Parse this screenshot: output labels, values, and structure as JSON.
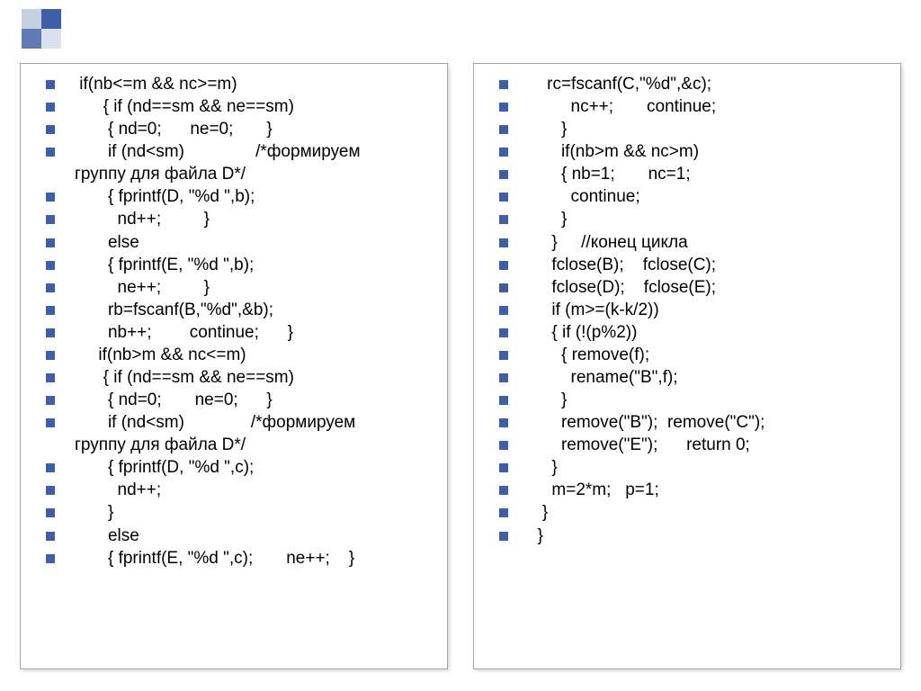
{
  "left": {
    "lines": [
      " if(nb<=m && nc>=m)",
      "      { if (nd==sm && ne==sm)",
      "       { nd=0;      ne=0;       }",
      "       if (nd<sm)               /*формируем",
      "       { fprintf(D, \"%d \",b);",
      "         nd++;         }",
      "       else",
      "       { fprintf(E, \"%d \",b);",
      "         ne++;         }",
      "       rb=fscanf(B,\"%d\",&b);",
      "       nb++;        continue;      }",
      "     if(nb>m && nc<=m)",
      "      { if (nd==sm && ne==sm)",
      "       { nd=0;       ne=0;      }",
      "       if (nd<sm)              /*формируем",
      "       { fprintf(D, \"%d \",c);",
      "         nd++;",
      "       }",
      "       else",
      "       { fprintf(E, \"%d \",c);       ne++;    }"
    ],
    "wrap_text": "группу для файла D*/",
    "wrap_after": [
      3,
      14
    ]
  },
  "right": {
    "lines": [
      "    rc=fscanf(C,\"%d\",&c);",
      "         nc++;       continue;",
      "       }",
      "       if(nb>m && nc>m)",
      "       { nb=1;       nc=1;",
      "         continue;",
      "       }",
      "     }     //конец цикла",
      "     fclose(B);    fclose(C);",
      "     fclose(D);    fclose(E);",
      "     if (m>=(k-k/2))",
      "     { if (!(p%2))",
      "       { remove(f);",
      "         rename(\"B\",f);",
      "       }",
      "       remove(\"B\");  remove(\"C\");",
      "       remove(\"E\");      return 0;",
      "     }",
      "     m=2*m;   p=1;",
      "   }",
      "  }"
    ]
  }
}
